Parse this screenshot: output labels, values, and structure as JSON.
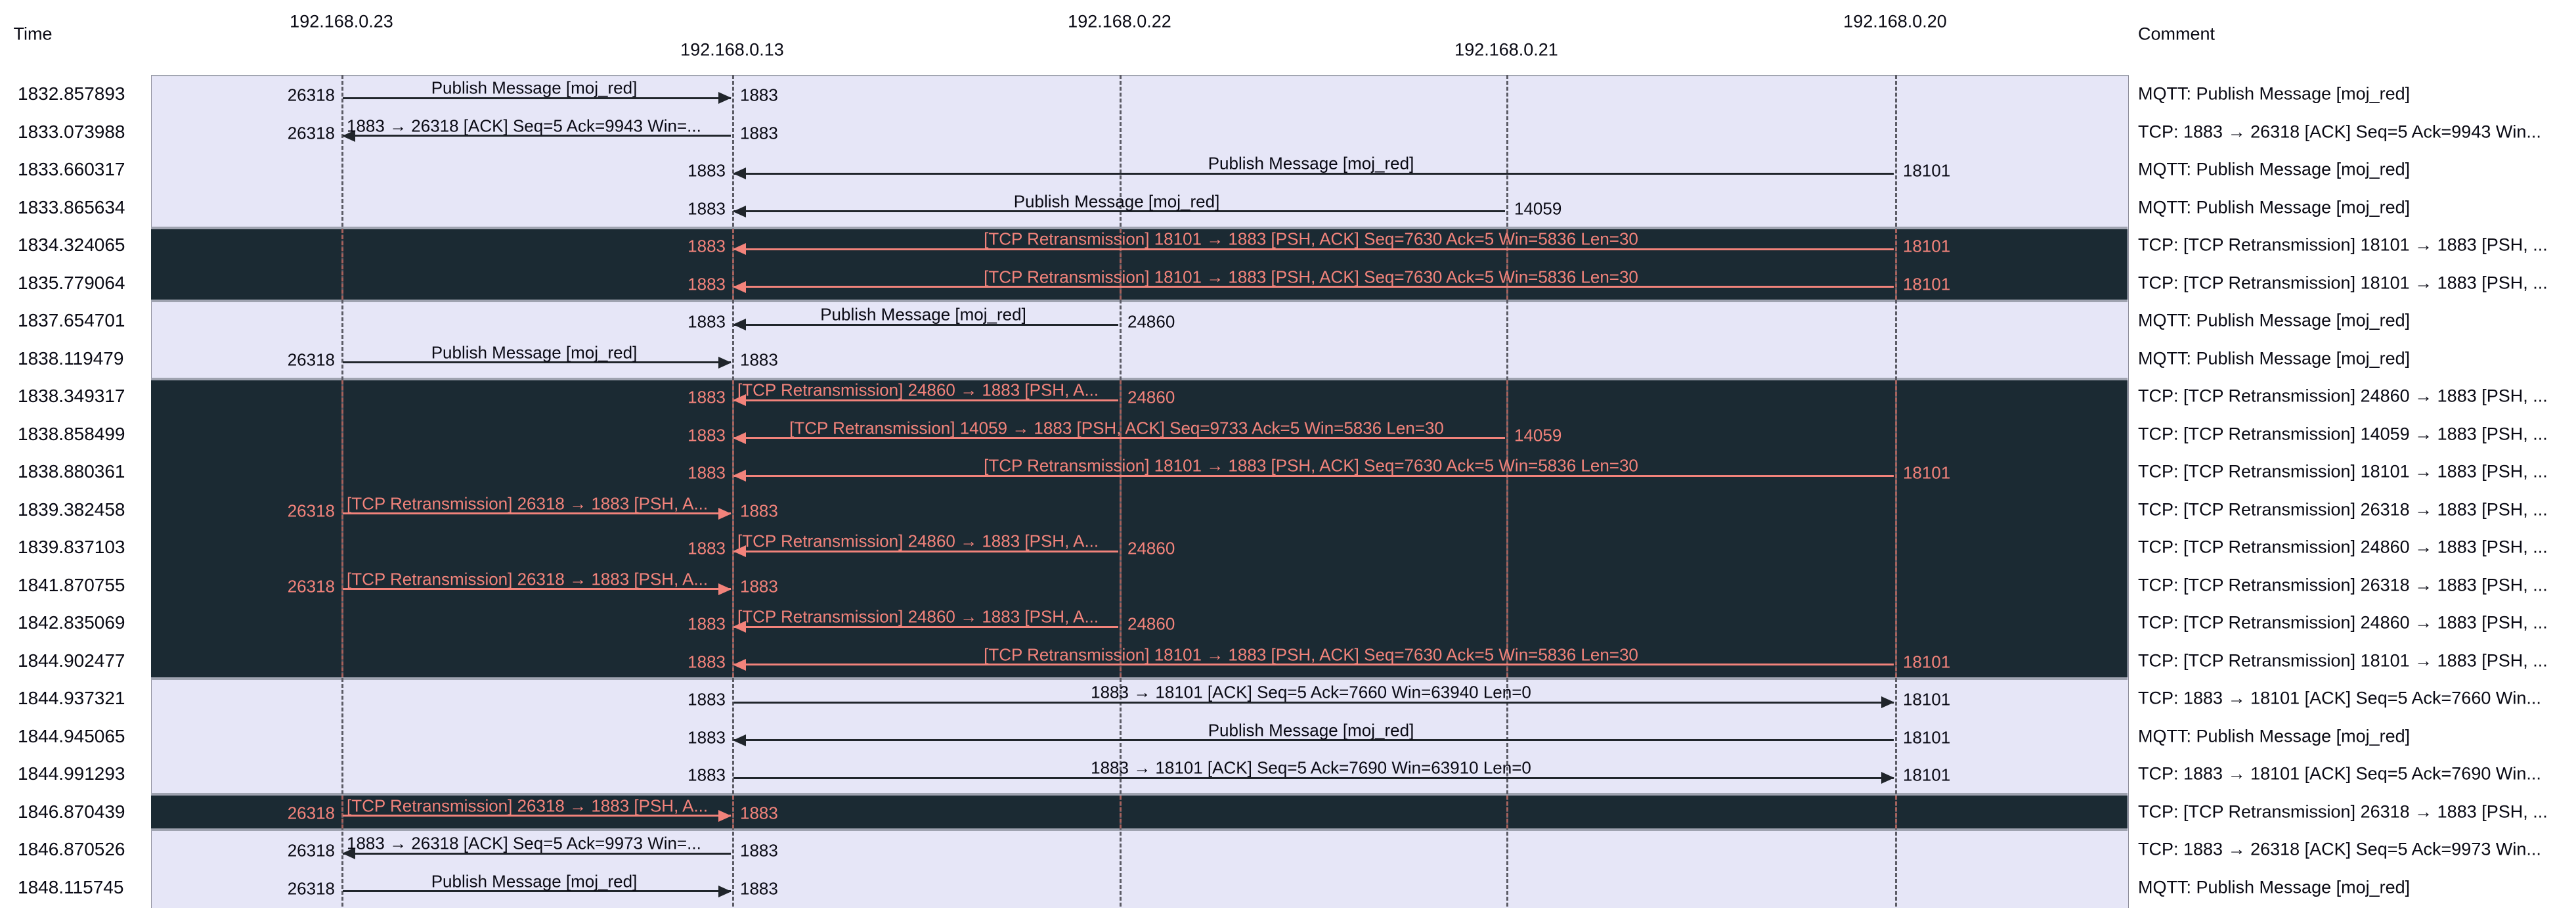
{
  "header": {
    "time_label": "Time",
    "comment_label": "Comment"
  },
  "nodes": [
    {
      "ip": "192.168.0.23",
      "stagger": "top"
    },
    {
      "ip": "192.168.0.13",
      "stagger": "bottom"
    },
    {
      "ip": "192.168.0.22",
      "stagger": "top"
    },
    {
      "ip": "192.168.0.21",
      "stagger": "bottom"
    },
    {
      "ip": "192.168.0.20",
      "stagger": "top"
    }
  ],
  "colors": {
    "row_light": "#e6e6f7",
    "row_dark": "#1b2a33",
    "retransmission": "#f2837b",
    "arrow_normal": "#20252b",
    "separator": "#9fa3b0",
    "lifeline": "#5c5c66",
    "lifeline_on_dark": "#a5615c",
    "text": "#0a0a14"
  },
  "rows": [
    {
      "time": "1832.857893",
      "dark": false,
      "from": 0,
      "to": 1,
      "label": "Publish Message [moj_red]",
      "align": "center",
      "left_port": "26318",
      "right_port": "1883",
      "comment": "MQTT: Publish Message [moj_red]"
    },
    {
      "time": "1833.073988",
      "dark": false,
      "from": 1,
      "to": 0,
      "label": "1883 → 26318 [ACK] Seq=5 Ack=9943 Win=...",
      "align": "start",
      "left_port": "26318",
      "right_port": "1883",
      "comment": "TCP: 1883 → 26318 [ACK] Seq=5 Ack=9943 Win..."
    },
    {
      "time": "1833.660317",
      "dark": false,
      "from": 4,
      "to": 1,
      "label": "Publish Message [moj_red]",
      "align": "center",
      "left_port": "1883",
      "right_port": "18101",
      "comment": "MQTT: Publish Message [moj_red]"
    },
    {
      "time": "1833.865634",
      "dark": false,
      "from": 3,
      "to": 1,
      "label": "Publish Message [moj_red]",
      "align": "center",
      "left_port": "1883",
      "right_port": "14059",
      "comment": "MQTT: Publish Message [moj_red]"
    },
    {
      "time": "1834.324065",
      "dark": true,
      "from": 4,
      "to": 1,
      "label": "[TCP Retransmission] 18101 → 1883 [PSH, ACK] Seq=7630 Ack=5 Win=5836 Len=30",
      "align": "center",
      "left_port": "1883",
      "right_port": "18101",
      "comment": "TCP: [TCP Retransmission] 18101 → 1883 [PSH, ..."
    },
    {
      "time": "1835.779064",
      "dark": true,
      "from": 4,
      "to": 1,
      "label": "[TCP Retransmission] 18101 → 1883 [PSH, ACK] Seq=7630 Ack=5 Win=5836 Len=30",
      "align": "center",
      "left_port": "1883",
      "right_port": "18101",
      "comment": "TCP: [TCP Retransmission] 18101 → 1883 [PSH, ..."
    },
    {
      "time": "1837.654701",
      "dark": false,
      "from": 2,
      "to": 1,
      "label": "Publish Message [moj_red]",
      "align": "center",
      "left_port": "1883",
      "right_port": "24860",
      "comment": "MQTT: Publish Message [moj_red]"
    },
    {
      "time": "1838.119479",
      "dark": false,
      "from": 0,
      "to": 1,
      "label": "Publish Message [moj_red]",
      "align": "center",
      "left_port": "26318",
      "right_port": "1883",
      "comment": "MQTT: Publish Message [moj_red]"
    },
    {
      "time": "1838.349317",
      "dark": true,
      "from": 2,
      "to": 1,
      "label": "[TCP Retransmission] 24860 → 1883 [PSH, A...",
      "align": "start",
      "left_port": "1883",
      "right_port": "24860",
      "comment": "TCP: [TCP Retransmission] 24860 → 1883 [PSH, ..."
    },
    {
      "time": "1838.858499",
      "dark": true,
      "from": 3,
      "to": 1,
      "label": "[TCP Retransmission] 14059 → 1883 [PSH, ACK] Seq=9733 Ack=5 Win=5836 Len=30",
      "align": "center",
      "left_port": "1883",
      "right_port": "14059",
      "comment": "TCP: [TCP Retransmission] 14059 → 1883 [PSH, ..."
    },
    {
      "time": "1838.880361",
      "dark": true,
      "from": 4,
      "to": 1,
      "label": "[TCP Retransmission] 18101 → 1883 [PSH, ACK] Seq=7630 Ack=5 Win=5836 Len=30",
      "align": "center",
      "left_port": "1883",
      "right_port": "18101",
      "comment": "TCP: [TCP Retransmission] 18101 → 1883 [PSH, ..."
    },
    {
      "time": "1839.382458",
      "dark": true,
      "from": 0,
      "to": 1,
      "label": "[TCP Retransmission] 26318 → 1883 [PSH, A...",
      "align": "start",
      "left_port": "26318",
      "right_port": "1883",
      "comment": "TCP: [TCP Retransmission] 26318 → 1883 [PSH, ..."
    },
    {
      "time": "1839.837103",
      "dark": true,
      "from": 2,
      "to": 1,
      "label": "[TCP Retransmission] 24860 → 1883 [PSH, A...",
      "align": "start",
      "left_port": "1883",
      "right_port": "24860",
      "comment": "TCP: [TCP Retransmission] 24860 → 1883 [PSH, ..."
    },
    {
      "time": "1841.870755",
      "dark": true,
      "from": 0,
      "to": 1,
      "label": "[TCP Retransmission] 26318 → 1883 [PSH, A...",
      "align": "start",
      "left_port": "26318",
      "right_port": "1883",
      "comment": "TCP: [TCP Retransmission] 26318 → 1883 [PSH, ..."
    },
    {
      "time": "1842.835069",
      "dark": true,
      "from": 2,
      "to": 1,
      "label": "[TCP Retransmission] 24860 → 1883 [PSH, A...",
      "align": "start",
      "left_port": "1883",
      "right_port": "24860",
      "comment": "TCP: [TCP Retransmission] 24860 → 1883 [PSH, ..."
    },
    {
      "time": "1844.902477",
      "dark": true,
      "from": 4,
      "to": 1,
      "label": "[TCP Retransmission] 18101 → 1883 [PSH, ACK] Seq=7630 Ack=5 Win=5836 Len=30",
      "align": "center",
      "left_port": "1883",
      "right_port": "18101",
      "comment": "TCP: [TCP Retransmission] 18101 → 1883 [PSH, ..."
    },
    {
      "time": "1844.937321",
      "dark": false,
      "from": 1,
      "to": 4,
      "label": "1883 → 18101 [ACK] Seq=5 Ack=7660 Win=63940 Len=0",
      "align": "center",
      "left_port": "1883",
      "right_port": "18101",
      "comment": "TCP: 1883 → 18101 [ACK] Seq=5 Ack=7660 Win..."
    },
    {
      "time": "1844.945065",
      "dark": false,
      "from": 4,
      "to": 1,
      "label": "Publish Message [moj_red]",
      "align": "center",
      "left_port": "1883",
      "right_port": "18101",
      "comment": "MQTT: Publish Message [moj_red]"
    },
    {
      "time": "1844.991293",
      "dark": false,
      "from": 1,
      "to": 4,
      "label": "1883 → 18101 [ACK] Seq=5 Ack=7690 Win=63910 Len=0",
      "align": "center",
      "left_port": "1883",
      "right_port": "18101",
      "comment": "TCP: 1883 → 18101 [ACK] Seq=5 Ack=7690 Win..."
    },
    {
      "time": "1846.870439",
      "dark": true,
      "from": 0,
      "to": 1,
      "label": "[TCP Retransmission] 26318 → 1883 [PSH, A...",
      "align": "start",
      "left_port": "26318",
      "right_port": "1883",
      "comment": "TCP: [TCP Retransmission] 26318 → 1883 [PSH, ..."
    },
    {
      "time": "1846.870526",
      "dark": false,
      "from": 1,
      "to": 0,
      "label": "1883 → 26318 [ACK] Seq=5 Ack=9973 Win=...",
      "align": "start",
      "left_port": "26318",
      "right_port": "1883",
      "comment": "TCP: 1883 → 26318 [ACK] Seq=5 Ack=9973 Win..."
    },
    {
      "time": "1848.115745",
      "dark": false,
      "from": 0,
      "to": 1,
      "label": "Publish Message [moj_red]",
      "align": "center",
      "left_port": "26318",
      "right_port": "1883",
      "comment": "MQTT: Publish Message [moj_red]"
    }
  ]
}
